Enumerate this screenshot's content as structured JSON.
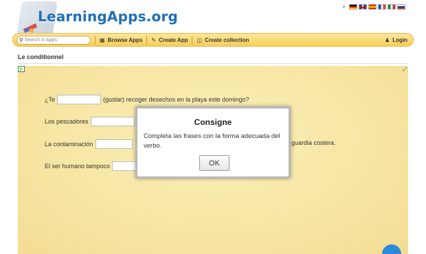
{
  "header": {
    "logo_text": "LearningApps.org",
    "lang_arrow": "▾",
    "flags": [
      "de",
      "gb",
      "es",
      "fr",
      "it",
      "ru"
    ]
  },
  "nav": {
    "search_placeholder": "Search in Apps",
    "browse_label": "Browse Apps",
    "create_label": "Create App",
    "collection_label": "Create collection",
    "login_label": "Login"
  },
  "page": {
    "title": "Le conditionnel"
  },
  "exercise": {
    "line1_pre": "¿Te",
    "line1_post": "(gustar) recoger desechos en la playa este domingo?",
    "line2_pre": "Los pescadores",
    "line3_pre": "La contaminación",
    "line3_post": "guardia costera.",
    "line4_pre": "El ser humano tampoco"
  },
  "modal": {
    "title": "Consigne",
    "text": "Completa las frases con la forma adecuada del verbo.",
    "ok_label": "OK"
  },
  "colors": {
    "nav_bg": "#f7cf57",
    "app_bg": "#f7e6a4",
    "logo_blue": "#1f6fb7",
    "accent_button": "#2d8ad8"
  },
  "icons": {
    "search": "magnifier-icon",
    "browse": "grid-icon",
    "create": "pencil-icon",
    "collection": "collection-icon",
    "login": "user-icon",
    "help": "help-icon",
    "fullscreen": "fullscreen-icon"
  }
}
